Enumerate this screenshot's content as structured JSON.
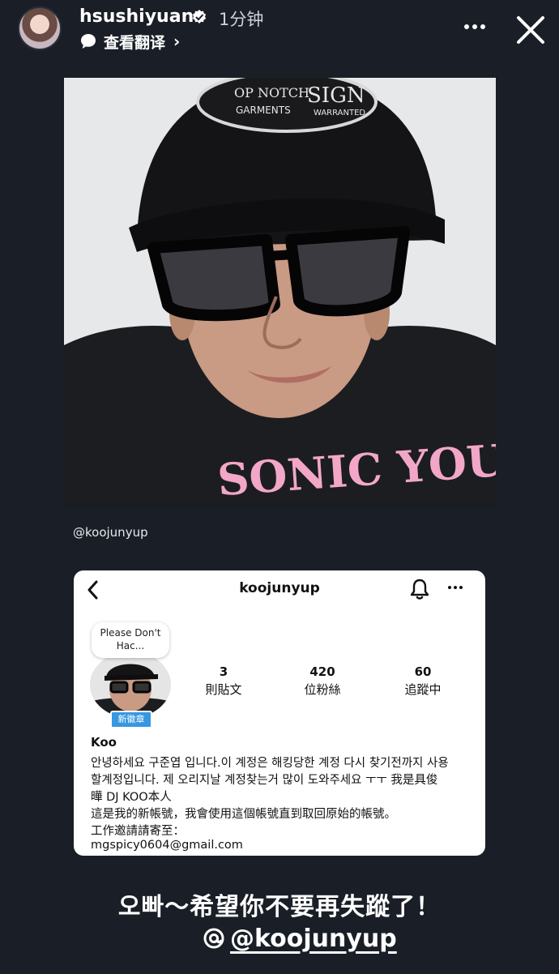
{
  "header": {
    "username": "hsushiyuan",
    "time": "1分钟",
    "translate_label": "查看翻译"
  },
  "post": {
    "mention_small": "@koojunyup",
    "photo": {
      "cap_text_line1": "OP NOTCH",
      "cap_text_line2": "SIGN",
      "cap_text_line3": "GARMENTS",
      "cap_text_line4": "WARRANTED",
      "shirt_text": "SONIC YOU"
    }
  },
  "profile_card": {
    "title": "koojunyup",
    "note": "Please Don't Hac...",
    "badge": "新徽章",
    "stats": {
      "posts_num": "3",
      "posts_label": "則貼文",
      "followers_num": "420",
      "followers_label": "位粉絲",
      "following_num": "60",
      "following_label": "追蹤中"
    },
    "name": "Koo",
    "bio_lines": [
      "안녕하세요 구준엽 입니다.이 계정은 해킹당한 계정 다시 찾기전까지 사용",
      "할계정입니다. 제 오리지날 계정찾는거 많이 도와주세요 ㅜㅜ 我是具俊",
      "曄 DJ KOO本人",
      "這是我的新帳號，我會使用這個帳號直到取回原始的帳號。",
      "工作邀請請寄至：",
      "mgspicy0604@gmail.com"
    ]
  },
  "caption": {
    "line1": "오빠～希望你不要再失蹤了！",
    "mention": "@koojunyup"
  },
  "colors": {
    "background": "#1a1f27",
    "badge_blue": "#3797e0",
    "shirt_pink": "#f2a7c8"
  }
}
